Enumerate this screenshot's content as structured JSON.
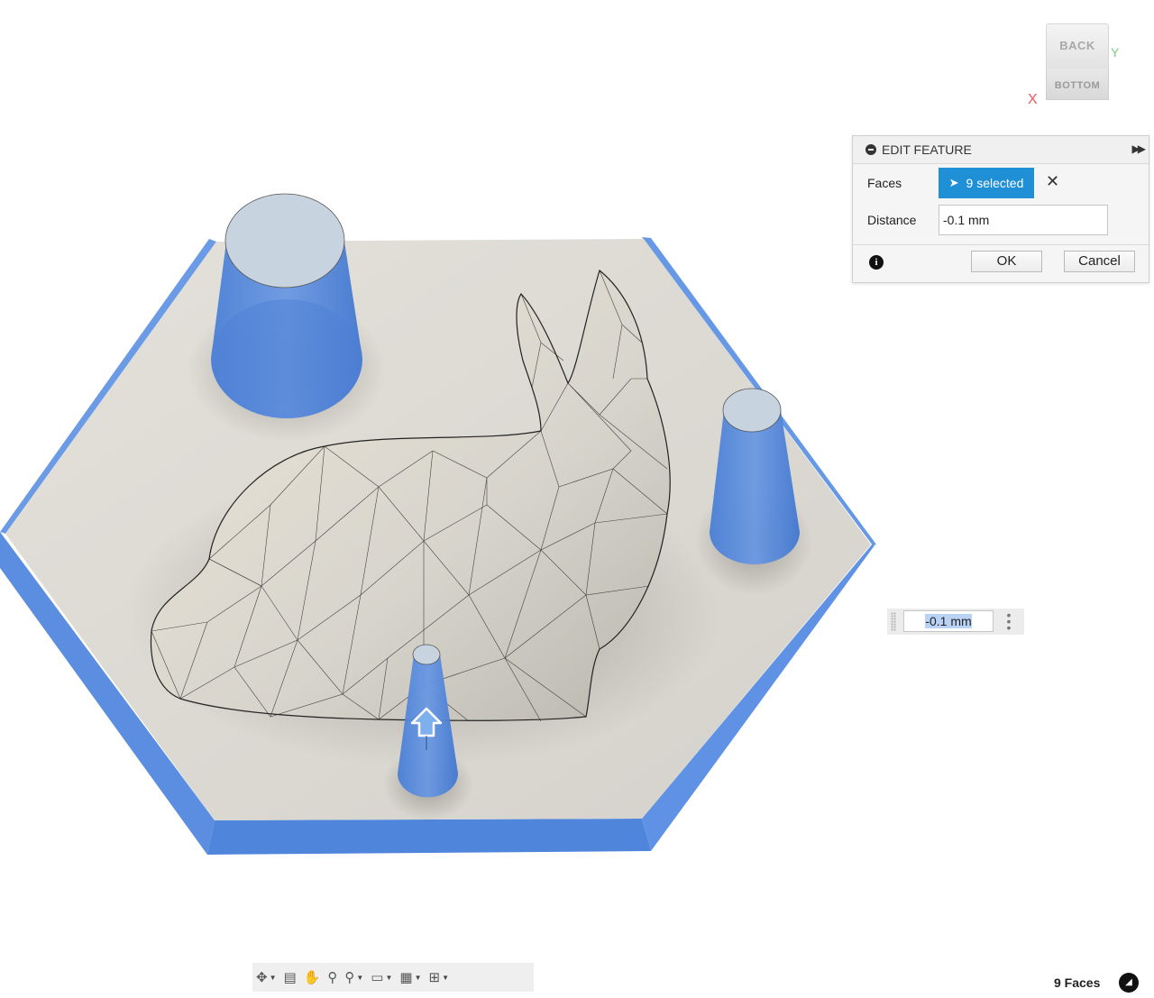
{
  "view_cube": {
    "back_label": "BACK",
    "bottom_label": "BOTTOM",
    "x_axis": "X",
    "y_axis": "Y"
  },
  "edit_feature": {
    "title": "EDIT FEATURE",
    "faces_label": "Faces",
    "faces_selected": "9 selected",
    "distance_label": "Distance",
    "distance_value": "-0.1 mm",
    "ok_label": "OK",
    "cancel_label": "Cancel"
  },
  "floating_input": {
    "value": "-0.1 mm"
  },
  "toolbar": {
    "tools": [
      "orbit-icon",
      "look-at-icon",
      "pan-icon",
      "zoom-icon",
      "fit-icon",
      "display-settings-icon",
      "grid-settings-icon",
      "viewports-icon"
    ]
  },
  "status": {
    "selection": "9 Faces"
  },
  "colors": {
    "accent": "#1f8fd6",
    "selection_blue": "#4e83d6",
    "model_base": "#dcdad3"
  }
}
